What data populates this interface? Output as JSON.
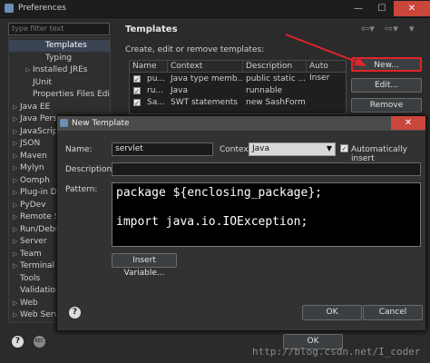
{
  "window": {
    "title": "Preferences"
  },
  "left": {
    "filter_placeholder": "type filter text",
    "items": [
      {
        "label": "Templates",
        "selected": true,
        "indent": 2,
        "arrow": ""
      },
      {
        "label": "Typing",
        "indent": 2,
        "arrow": ""
      },
      {
        "label": "Installed JREs",
        "indent": 1,
        "arrow": "▷"
      },
      {
        "label": "JUnit",
        "indent": 1,
        "arrow": ""
      },
      {
        "label": "Properties Files Edit",
        "indent": 1,
        "arrow": ""
      },
      {
        "label": "Java EE",
        "indent": 0,
        "arrow": "▷"
      },
      {
        "label": "Java Pers",
        "indent": 0,
        "arrow": "▷"
      },
      {
        "label": "JavaScrip",
        "indent": 0,
        "arrow": "▷"
      },
      {
        "label": "JSON",
        "indent": 0,
        "arrow": "▷"
      },
      {
        "label": "Maven",
        "indent": 0,
        "arrow": "▷"
      },
      {
        "label": "Mylyn",
        "indent": 0,
        "arrow": "▷"
      },
      {
        "label": "Oomph",
        "indent": 0,
        "arrow": "▷"
      },
      {
        "label": "Plug-in D",
        "indent": 0,
        "arrow": "▷"
      },
      {
        "label": "PyDev",
        "indent": 0,
        "arrow": "▷"
      },
      {
        "label": "Remote Sy",
        "indent": 0,
        "arrow": "▷"
      },
      {
        "label": "Run/Debu",
        "indent": 0,
        "arrow": "▷"
      },
      {
        "label": "Server",
        "indent": 0,
        "arrow": "▷"
      },
      {
        "label": "Team",
        "indent": 0,
        "arrow": "▷"
      },
      {
        "label": "Terminal",
        "indent": 0,
        "arrow": "▷"
      },
      {
        "label": "Tools",
        "indent": 0,
        "arrow": ""
      },
      {
        "label": "Validation",
        "indent": 0,
        "arrow": ""
      },
      {
        "label": "Web",
        "indent": 0,
        "arrow": "▷"
      },
      {
        "label": "Web Serv",
        "indent": 0,
        "arrow": "▷"
      }
    ]
  },
  "right": {
    "title": "Templates",
    "description": "Create, edit or remove templates:",
    "columns": [
      "Name",
      "Context",
      "Description",
      "Auto Inser"
    ],
    "rows": [
      {
        "name": "pu...",
        "context": "Java type memb...",
        "description": "public static ...",
        "checked": true
      },
      {
        "name": "ru...",
        "context": "Java",
        "description": "runnable",
        "checked": true
      },
      {
        "name": "Sa...",
        "context": "SWT statements",
        "description": "new SashForm",
        "checked": true
      }
    ],
    "buttons": {
      "new": "New...",
      "edit": "Edit...",
      "remove": "Remove"
    }
  },
  "dialog": {
    "title": "New Template",
    "name_label": "Name:",
    "name_value": "servlet",
    "context_label": "Context:",
    "context_value": "Java",
    "auto_insert_label": "Automatically insert",
    "auto_insert_checked": true,
    "description_label": "Description:",
    "description_value": "",
    "pattern_label": "Pattern:",
    "pattern_lines": [
      "package ${enclosing_package};",
      "",
      "import java.io.IOException;"
    ],
    "insert_variable": "Insert Variable...",
    "ok": "OK",
    "cancel": "Cancel"
  },
  "footer": {
    "ok": "OK"
  },
  "watermark": "http://blog.csdn.net/I_coder",
  "colors": {
    "arrow_annotation": "#e0242a",
    "close_button": "#c9463b"
  }
}
